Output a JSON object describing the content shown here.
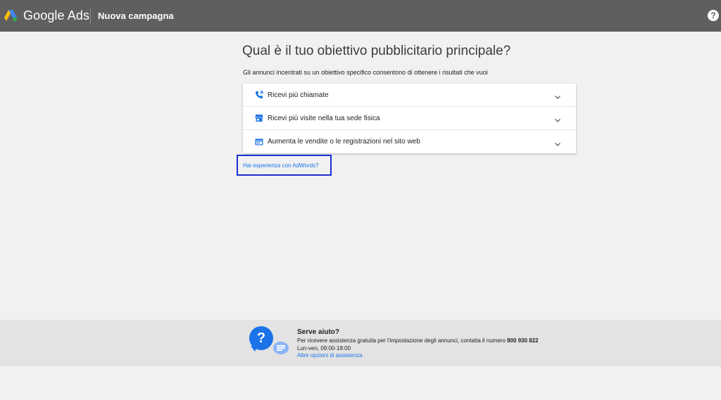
{
  "header": {
    "brand": "Google Ads",
    "page_title": "Nuova campagna",
    "help_icon": "help-icon"
  },
  "main": {
    "heading": "Qual è il tuo obiettivo pubblicitario principale?",
    "subtext": "Gli annunci incentrati su un obiettivo specifico consentono di ottenere i risultati che vuoi",
    "options": [
      {
        "label": "Ricevi più chiamate",
        "icon": "phone-icon"
      },
      {
        "label": "Ricevi più visite nella tua sede fisica",
        "icon": "store-icon"
      },
      {
        "label": "Aumenta le vendite o le registrazioni nel sito web",
        "icon": "web-icon"
      }
    ],
    "adwords_link": "Hai esperienza con AdWords?"
  },
  "footer": {
    "title": "Serve aiuto?",
    "text": "Per ricevere assistenza gratuita per l'impostazione degli annunci, contatta il numero",
    "phone": "800 930 822",
    "hours": "Lun-ven, 09:00-18:00",
    "link": "Altre opzioni di assistenza"
  },
  "colors": {
    "topbar": "#5f5f5f",
    "accent": "#1a73e8",
    "highlight_box": "#1b2fd1"
  }
}
